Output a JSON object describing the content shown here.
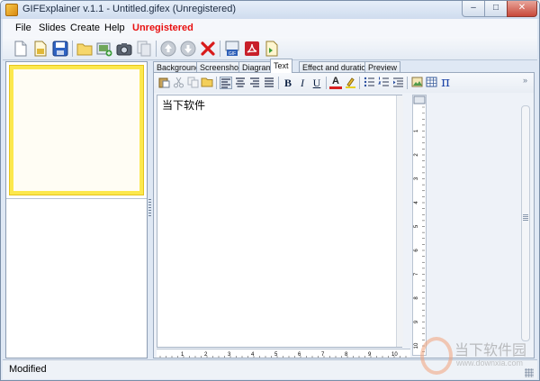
{
  "window": {
    "title": "GIFExplainer v.1.1 - Untitled.gifex (Unregistered)",
    "minimize_glyph": "–",
    "maximize_glyph": "□",
    "close_glyph": "✕"
  },
  "menu": {
    "items": [
      "File",
      "Slides",
      "Create",
      "Help"
    ],
    "unregistered": "Unregistered"
  },
  "toolbar": {
    "icons": [
      "new-file-icon",
      "open-file-icon",
      "save-icon",
      "folder-icon",
      "add-image-icon",
      "camera-icon",
      "copy-slide-icon",
      "move-up-icon",
      "move-down-icon",
      "delete-icon",
      "gif-export-icon",
      "pdf-export-icon",
      "export-icon"
    ]
  },
  "tabs": [
    "Background",
    "Screenshot",
    "Diagram",
    "Text",
    "Effect and duration",
    "Preview"
  ],
  "active_tab": "Text",
  "format_bar": {
    "bold": "B",
    "italic": "I",
    "underline": "U",
    "font_color": "A",
    "pi": "π",
    "more": "»"
  },
  "editor": {
    "text": "当下软件"
  },
  "ruler": {
    "horizontal_ticks": [
      "1",
      "2",
      "3",
      "4",
      "5",
      "6",
      "7",
      "8",
      "9",
      "10"
    ],
    "vertical_ticks": [
      "1",
      "2",
      "3",
      "4",
      "5",
      "6",
      "7",
      "8",
      "9",
      "10"
    ]
  },
  "status": {
    "text": "Modified"
  },
  "watermark": {
    "main": "当下软件园",
    "url": "www.downxia.com"
  },
  "colors": {
    "thumb_border": "#fce84e",
    "unregistered": "#e81010",
    "delete": "#d81b1b",
    "pdf": "#c8202a"
  }
}
